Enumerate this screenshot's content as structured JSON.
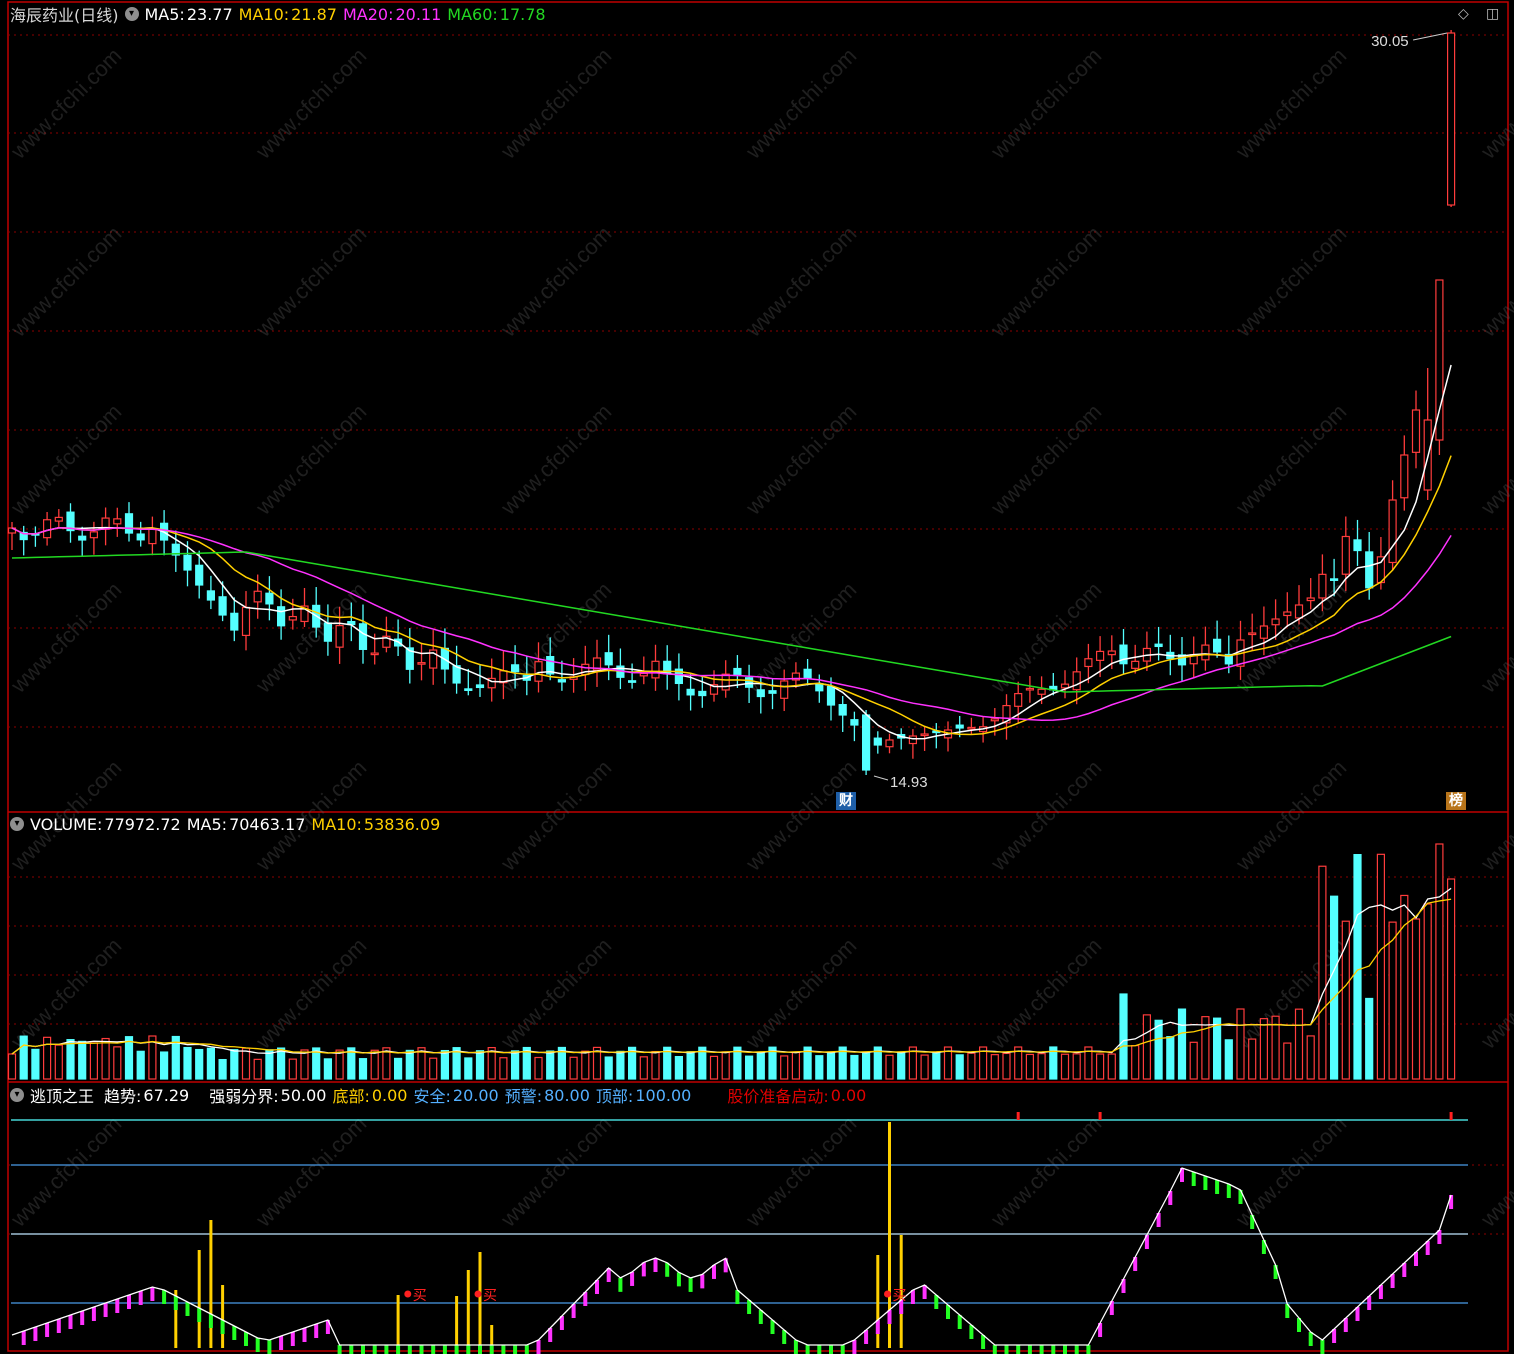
{
  "main": {
    "stock_name": "海辰药业(日线)",
    "ma5_label": "MA5:",
    "ma5": "23.77",
    "ma10_label": "MA10:",
    "ma10": "21.87",
    "ma20_label": "MA20:",
    "ma20": "20.11",
    "ma60_label": "MA60:",
    "ma60": "17.78",
    "high_mark": "30.05",
    "low_mark": "14.93",
    "event_cai": "财",
    "event_bang": "榜"
  },
  "volume": {
    "title_label": "VOLUME:",
    "value": "77972.72",
    "ma5_label": "MA5:",
    "ma5": "70463.17",
    "ma10_label": "MA10:",
    "ma10": "53836.09"
  },
  "indicator": {
    "name": "逃顶之王",
    "trend_label": "趋势:",
    "trend": "67.29",
    "divide_label": "强弱分界:",
    "divide": "50.00",
    "bottom_label": "底部:",
    "bottom": "0.00",
    "safe_label": "安全:",
    "safe": "20.00",
    "warn_label": "预警:",
    "warn": "80.00",
    "top_label": "顶部:",
    "top": "100.00",
    "start_label": "股价准备启动:",
    "start": "0.00",
    "buy_text": "买"
  },
  "watermark_text": "www.cfchi.com",
  "colors": {
    "up": "#ff3c3c",
    "down": "#54ffff",
    "ma5": "#ffffff",
    "ma10": "#ffd000",
    "ma20": "#ff32ff",
    "ma60": "#22d822",
    "grid": "#8b0000",
    "border": "#c00000"
  }
}
